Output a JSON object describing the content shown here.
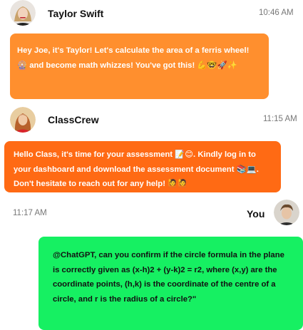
{
  "messages": [
    {
      "sender": "Taylor Swift",
      "time": "10:46 AM",
      "text": "Hey Joe, it's Taylor! Let's calculate the area of a ferris wheel! 🎡 and become math whizzes! You've got this! 💪🤓🚀✨",
      "avatar_icon": "user-avatar-taylor",
      "bubble_color": "#FF8F2E"
    },
    {
      "sender": "ClassCrew",
      "time": "11:15 AM",
      "text": "Hello Class, it's time for your assessment 📝😊. Kindly log in to your dashboard and download the assessment document 📚💻. Don't hesitate to reach out for any help! 🙋🙋",
      "avatar_icon": "user-avatar-classcrew",
      "bubble_color": "#FF6A14"
    },
    {
      "sender": "You",
      "time": "11:17 AM",
      "text": "@ChatGPT, can you confirm if the circle formula in the plane is correctly given as (x-h)2 + (y-k)2 = r2, where (x,y) are the coordinate points, (h,k) is the coordinate of the centre of a circle, and r is the radius of a circle?\"",
      "avatar_icon": "user-avatar-you",
      "bubble_color": "#16F062"
    }
  ]
}
